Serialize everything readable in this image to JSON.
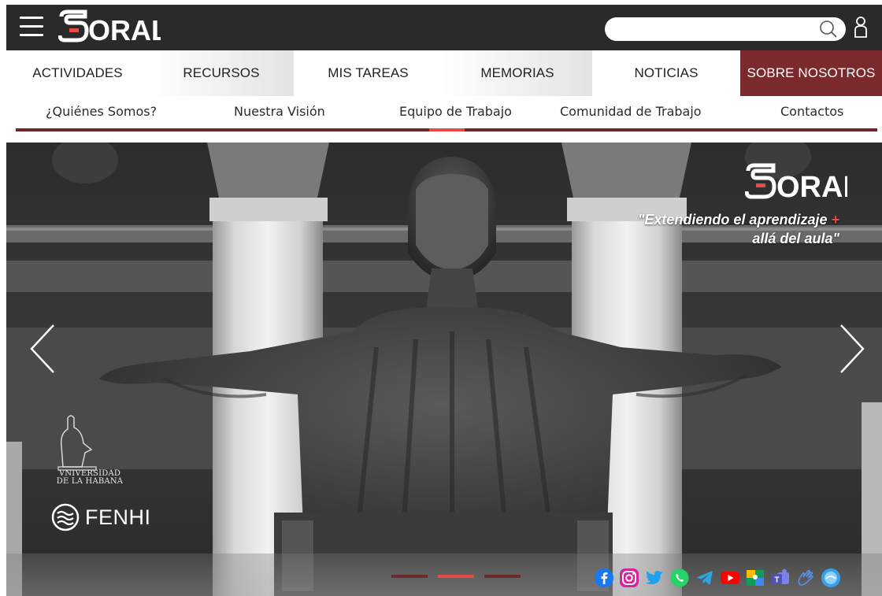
{
  "header": {
    "logo_text": "ORAL",
    "search": {
      "value": "",
      "placeholder": ""
    },
    "icons": {
      "menu": "hamburger-menu-icon",
      "search": "search-icon",
      "user": "user-icon"
    }
  },
  "nav": {
    "items": [
      {
        "label": "ACTIVIDADES"
      },
      {
        "label": "RECURSOS"
      },
      {
        "label": "MIS TAREAS"
      },
      {
        "label": "MEMORIAS"
      },
      {
        "label": "NOTICIAS"
      },
      {
        "label": "SOBRE NOSOTROS",
        "active": true
      }
    ]
  },
  "subnav": {
    "items": [
      {
        "label": "¿Quiénes Somos?"
      },
      {
        "label": "Nuestra Visión"
      },
      {
        "label": "Equipo de Trabajo",
        "active": true
      },
      {
        "label": "Comunidad de Trabajo"
      },
      {
        "label": "Contactos"
      }
    ]
  },
  "hero": {
    "logo_text": "ORAL",
    "tagline_line1": "\"Extendiendo el aprendizaje",
    "tagline_plus": "+",
    "tagline_line2": "allá del aula\"",
    "university_line1": "VNIVERSIDAD",
    "university_line2": "DE LA HABANA",
    "fenhi": "FENHI",
    "slides": {
      "count": 3,
      "active_index": 1
    },
    "social_icons": [
      "facebook-icon",
      "instagram-icon",
      "twitter-icon",
      "whatsapp-icon",
      "telegram-icon",
      "youtube-icon",
      "google-classroom-icon",
      "microsoft-teams-icon",
      "sign-language-icon",
      "universidad-virtual-icon"
    ]
  },
  "colors": {
    "topbar": "#2a2a2a",
    "brand_maroon": "#7a2a2c",
    "accent_red": "#e84a47"
  }
}
